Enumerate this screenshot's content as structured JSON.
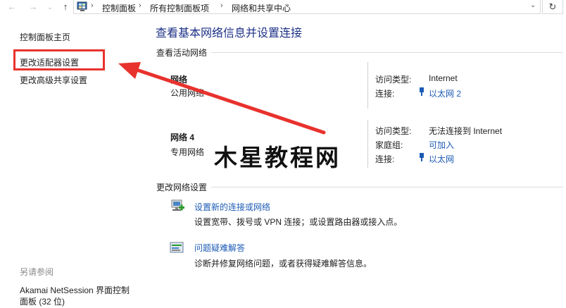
{
  "address_bar": {
    "breadcrumbs": [
      "控制面板",
      "所有控制面板项",
      "网络和共享中心"
    ]
  },
  "sidebar": {
    "home": "控制面板主页",
    "items": [
      "更改适配器设置",
      "更改高级共享设置"
    ],
    "see_also_title": "另请参阅",
    "see_also_item_line1": "Akamai NetSession 界面控制",
    "see_also_item_line2": "面板 (32 位)"
  },
  "main": {
    "title": "查看基本网络信息并设置连接",
    "active_section": "查看活动网络",
    "networks": [
      {
        "name": "网络",
        "type": "公用网络",
        "access_label": "访问类型:",
        "access_value": "Internet",
        "conn_label": "连接:",
        "conn_value": "以太网 2"
      },
      {
        "name": "网络  4",
        "type": "专用网络",
        "access_label": "访问类型:",
        "access_value": "无法连接到 Internet",
        "homegroup_label": "家庭组:",
        "homegroup_value": "可加入",
        "conn_label": "连接:",
        "conn_value": "以太网"
      }
    ],
    "change_section": "更改网络设置",
    "tasks": [
      {
        "icon": "new-connection-icon",
        "link": "设置新的连接或网络",
        "desc": "设置宽带、拨号或 VPN 连接；或设置路由器或接入点。"
      },
      {
        "icon": "troubleshoot-icon",
        "link": "问题疑难解答",
        "desc": "诊断并修复网络问题，或者获得疑难解答信息。"
      }
    ]
  },
  "overlay": {
    "watermark": "木星教程网",
    "highlight_color": "#e8322d"
  }
}
